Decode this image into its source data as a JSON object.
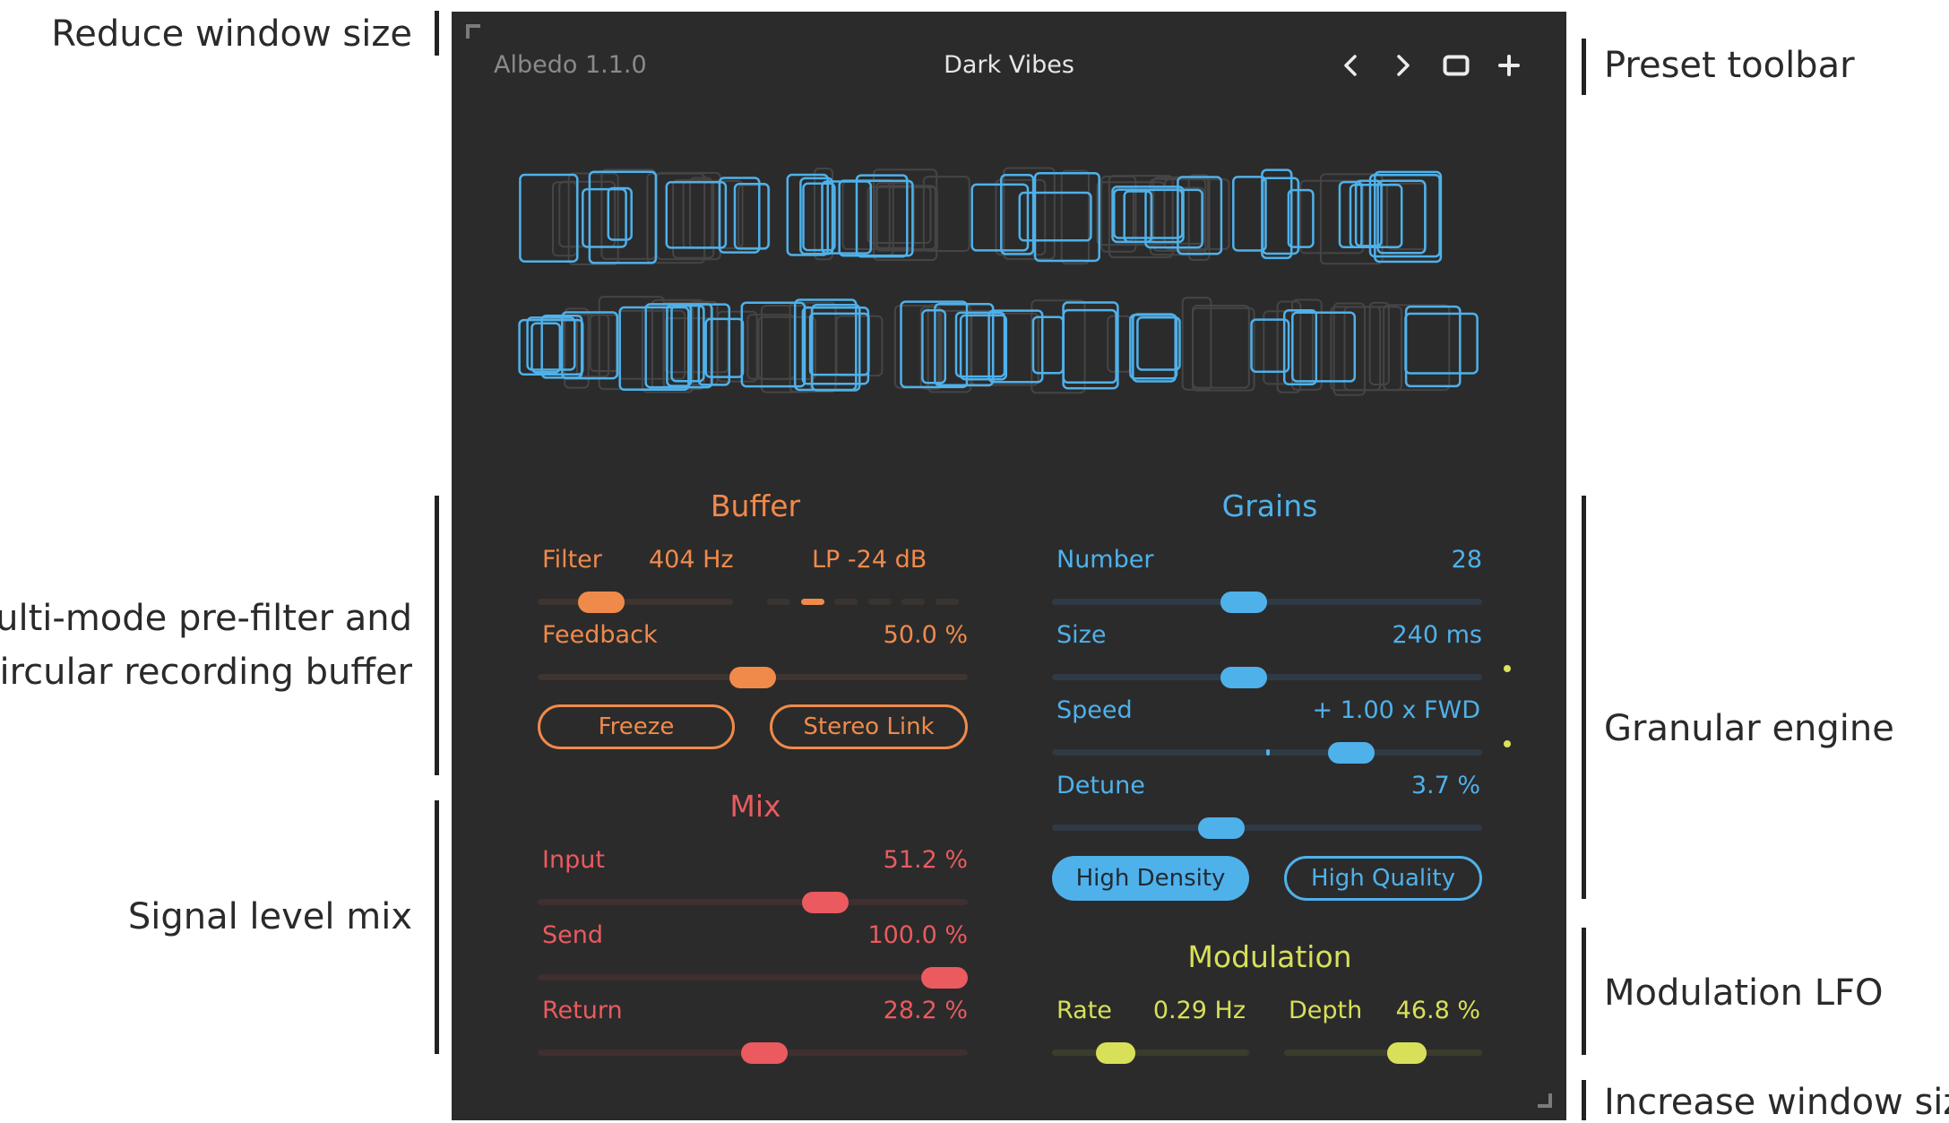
{
  "annotations": {
    "reduce": "Reduce window size",
    "prefilter_line1": "Multi-mode pre-filter and",
    "prefilter_line2": "circular recording buffer",
    "signal_mix": "Signal level mix",
    "preset_toolbar": "Preset toolbar",
    "granular": "Granular engine",
    "modulation_lfo": "Modulation LFO",
    "increase": "Increase window size"
  },
  "header": {
    "version": "Albedo 1.1.0",
    "preset_name": "Dark Vibes",
    "icons": [
      "chevron-left-icon",
      "chevron-right-icon",
      "square-icon",
      "plus-icon"
    ]
  },
  "buffer": {
    "title": "Buffer",
    "filter_label": "Filter",
    "filter_value": "404 Hz",
    "filter_mode": "LP -24 dB",
    "filter_slider": 0.27,
    "filter_mode_index": 1,
    "feedback_label": "Feedback",
    "feedback_value": "50.0 %",
    "feedback_slider": 0.5,
    "freeze_label": "Freeze",
    "stereo_link_label": "Stereo Link"
  },
  "mix": {
    "title": "Mix",
    "input_label": "Input",
    "input_value": "51.2 %",
    "input_slider": 0.69,
    "send_label": "Send",
    "send_value": "100.0 %",
    "send_slider": 1.0,
    "return_label": "Return",
    "return_value": "28.2 %",
    "return_slider": 0.53
  },
  "grains": {
    "title": "Grains",
    "number_label": "Number",
    "number_value": "28",
    "number_slider": 0.44,
    "size_label": "Size",
    "size_value": "240 ms",
    "size_slider": 0.44,
    "speed_label": "Speed",
    "speed_value": "+ 1.00 x FWD",
    "speed_slider": 0.72,
    "detune_label": "Detune",
    "detune_value": "3.7 %",
    "detune_slider": 0.38,
    "high_density_label": "High Density",
    "high_quality_label": "High Quality"
  },
  "modulation": {
    "title": "Modulation",
    "rate_label": "Rate",
    "rate_value": "0.29 Hz",
    "rate_slider": 0.28,
    "depth_label": "Depth",
    "depth_value": "46.8 %",
    "depth_slider": 0.65
  },
  "colors": {
    "background": "#2b2b2b",
    "buffer": "#f08a4b",
    "grains": "#4fb1ea",
    "mix": "#ea5a5f",
    "modulation": "#d8e05a"
  }
}
